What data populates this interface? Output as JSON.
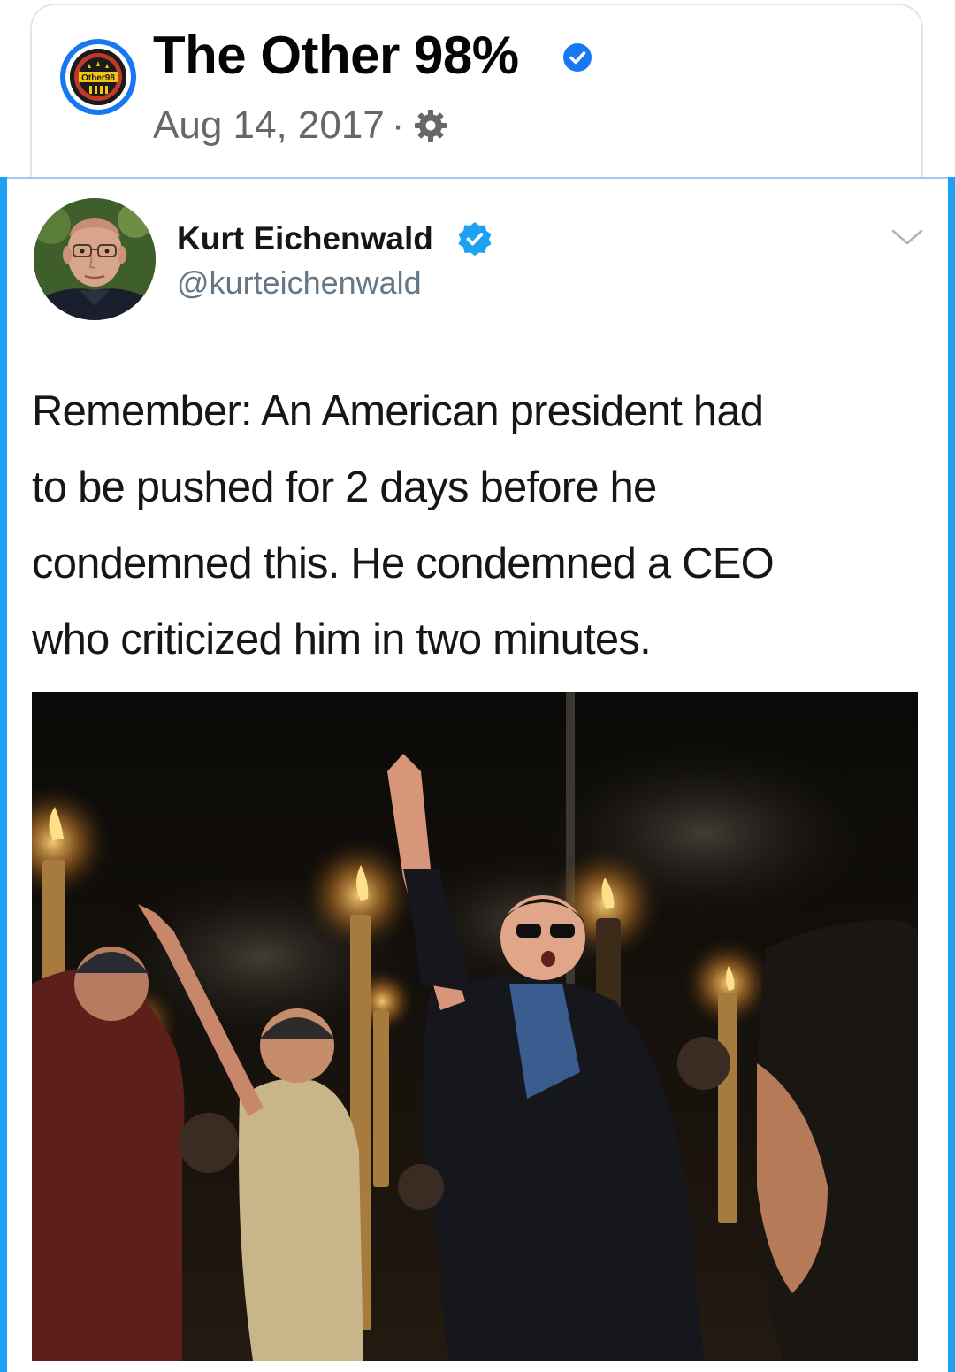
{
  "post": {
    "page_name": "The Other 98%",
    "date": "Aug 14, 2017",
    "separator": "·",
    "avatar_text": "Other98",
    "verified_icon": "verified-badge-icon",
    "audience_icon": "gear-icon",
    "colors": {
      "brand_blue": "#1877f2",
      "meta_gray": "#65676b"
    }
  },
  "tweet": {
    "author_name": "Kurt Eichenwald",
    "handle": "@kurteichenwald",
    "text_lines": [
      "Remember: An American president had",
      "to be pushed for 2 days before he",
      "condemned this. He condemned a CEO",
      "who criticized him in two minutes."
    ],
    "menu_icon": "chevron-down-icon",
    "colors": {
      "twitter_blue": "#1da1f2",
      "handle_gray": "#657786"
    }
  }
}
